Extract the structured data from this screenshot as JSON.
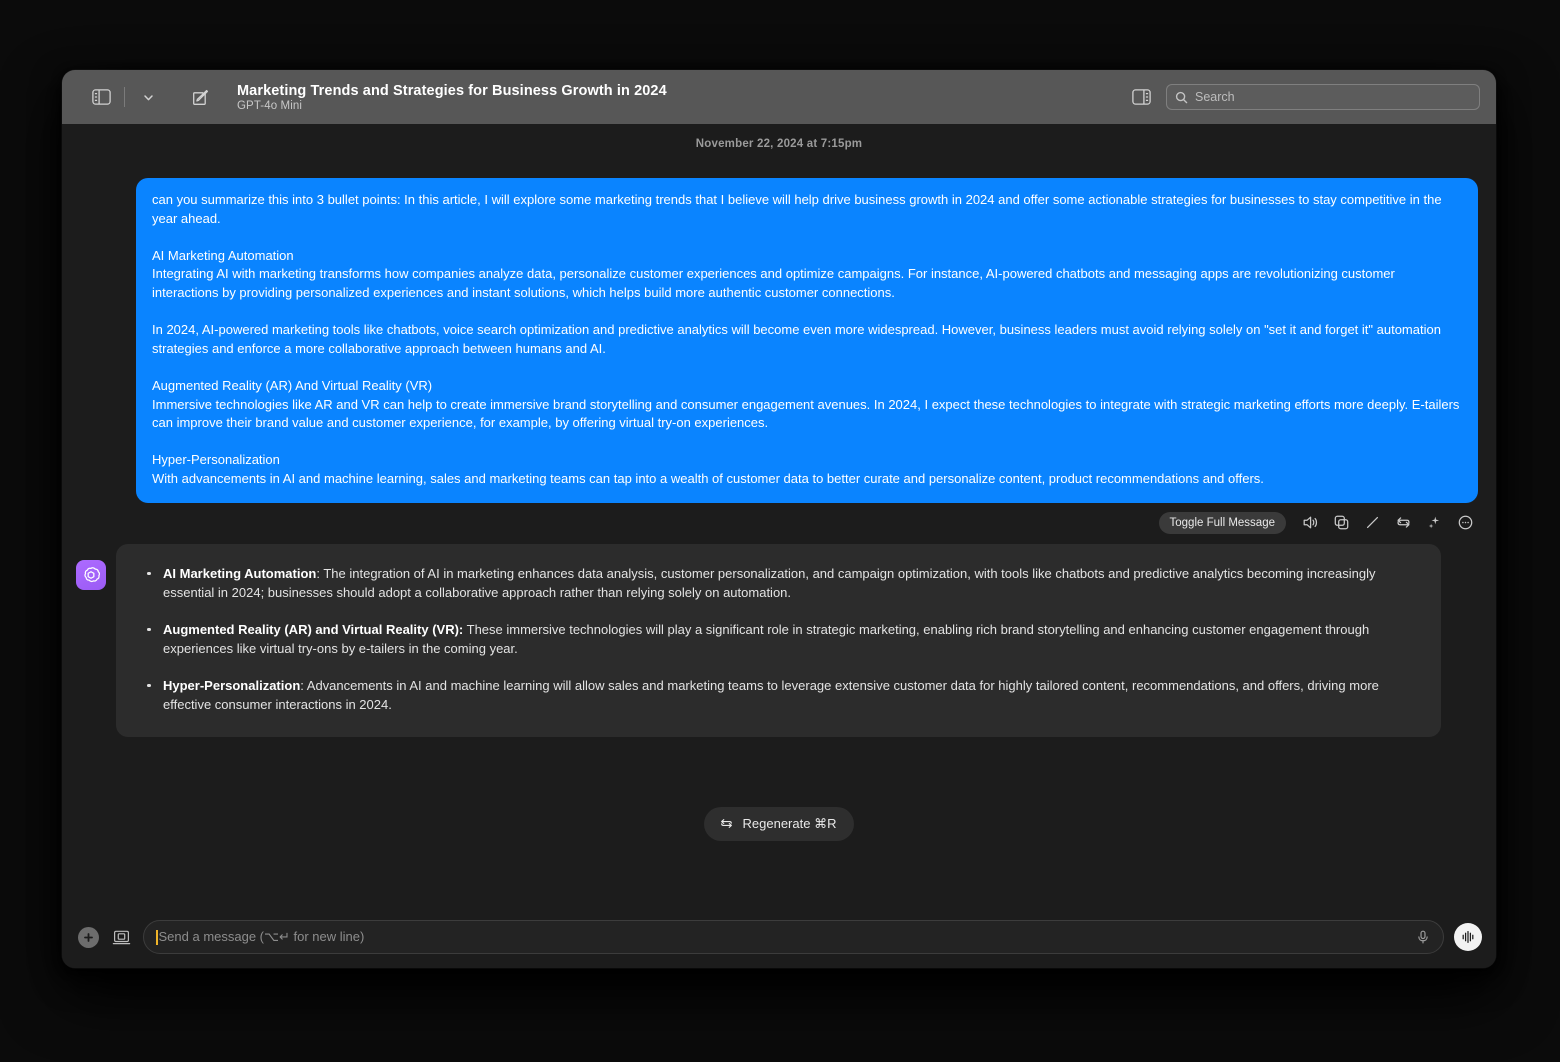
{
  "window": {
    "titlebar": {
      "sidebar_toggle_icon": "sidebar-left-icon",
      "chevron_icon": "chevron-down-icon",
      "new_chat_icon": "compose-icon",
      "title": "Marketing Trends and Strategies for Business Growth in 2024",
      "model": "GPT-4o Mini",
      "right_sidebar_icon": "sidebar-right-icon",
      "search": {
        "icon": "search-icon",
        "placeholder": "Search",
        "value": ""
      }
    }
  },
  "conversation": {
    "timestamp": "November 22, 2024 at 7:15pm",
    "user_message": {
      "paragraphs": [
        "can you summarize this into 3 bullet points: In this article, I will explore some marketing trends that I believe will help drive business growth in 2024 and offer some actionable strategies for businesses to stay competitive in the year ahead.",
        "AI Marketing Automation",
        "Integrating AI with marketing transforms how companies analyze data, personalize customer experiences and optimize campaigns. For instance, AI-powered chatbots and messaging apps are revolutionizing customer interactions by providing personalized experiences and instant solutions, which helps build more authentic customer connections.",
        "In 2024, AI-powered marketing tools like chatbots, voice search optimization and predictive analytics will become even more widespread. However, business leaders must avoid relying solely on \"set it and forget it\" automation strategies and enforce a more collaborative approach between humans and AI.",
        "Augmented Reality (AR) And Virtual Reality (VR)",
        "Immersive technologies like AR and VR can help to create immersive brand storytelling and consumer engagement avenues. In 2024, I expect these technologies to integrate with strategic marketing efforts more deeply. E-tailers can improve their brand value and customer experience, for example, by offering virtual try-on experiences.",
        "Hyper-Personalization",
        "With advancements in AI and machine learning, sales and marketing teams can tap into a wealth of customer data to better curate and personalize content, product recommendations and offers."
      ],
      "bubble_color": "#0a84ff"
    },
    "message_actions": {
      "toggle_label": "Toggle Full Message",
      "icons": [
        "speaker-icon",
        "copy-icon",
        "edit-pencil-icon",
        "retry-icon",
        "sparkle-icon",
        "more-options-icon"
      ]
    },
    "assistant_message": {
      "avatar_icon": "openai-logo-icon",
      "bullets": [
        {
          "title": "AI Marketing Automation",
          "body": ": The integration of AI in marketing enhances data analysis, customer personalization, and campaign optimization, with tools like chatbots and predictive analytics becoming increasingly essential in 2024; businesses should adopt a collaborative approach rather than relying solely on automation."
        },
        {
          "title": "Augmented Reality (AR) and Virtual Reality (VR):",
          "body": " These immersive technologies will play a significant role in strategic marketing, enabling rich brand storytelling and enhancing customer engagement through experiences like virtual try-ons by e-tailers in the coming year."
        },
        {
          "title": "Hyper-Personalization",
          "body": ": Advancements in AI and machine learning will allow sales and marketing teams to leverage extensive customer data for highly tailored content, recommendations, and offers, driving more effective consumer interactions in 2024."
        }
      ]
    },
    "regenerate": {
      "icon": "refresh-icon",
      "label": "Regenerate ⌘R"
    }
  },
  "composer": {
    "add_icon": "plus-icon",
    "screenshot_icon": "screenshot-icon",
    "placeholder": "Send a message (⌥↵ for new line)",
    "value": "",
    "mic_icon": "microphone-icon",
    "voice_icon": "voice-wave-icon"
  }
}
